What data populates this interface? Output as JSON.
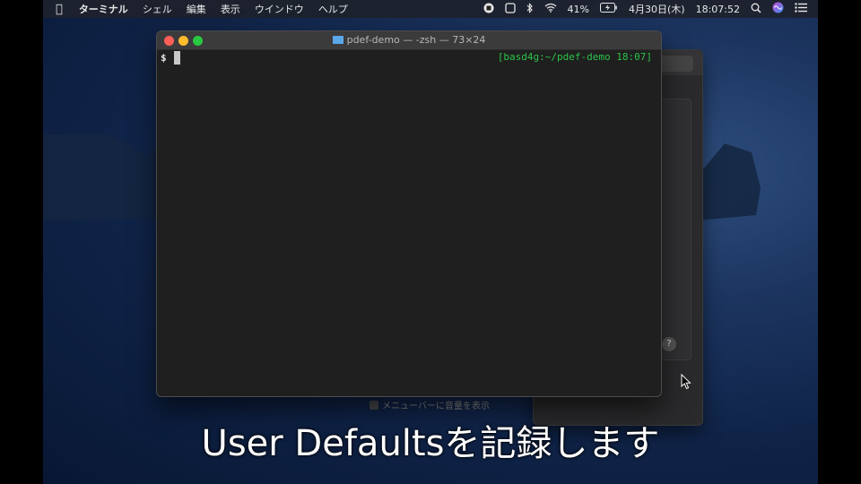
{
  "menubar": {
    "app_name": "ターミナル",
    "items": [
      "シェル",
      "編集",
      "表示",
      "ウインドウ",
      "ヘルプ"
    ],
    "battery": "41%",
    "date": "4月30日(木)",
    "time": "18:07:52"
  },
  "terminal": {
    "title": "pdef-demo — -zsh — 73×24",
    "prompt": "$",
    "right_prompt": "[basd4g:~/pdef-demo 18:07]"
  },
  "preferences": {
    "menubar_checkbox_label": "メニューバーに音量を表示",
    "help_label": "?"
  },
  "subtitle": "User Defaultsを記録します",
  "colors": {
    "prompt_green": "#2bc24a",
    "close": "#fe5f57",
    "minimize": "#febc2e",
    "maximize": "#28c840"
  }
}
